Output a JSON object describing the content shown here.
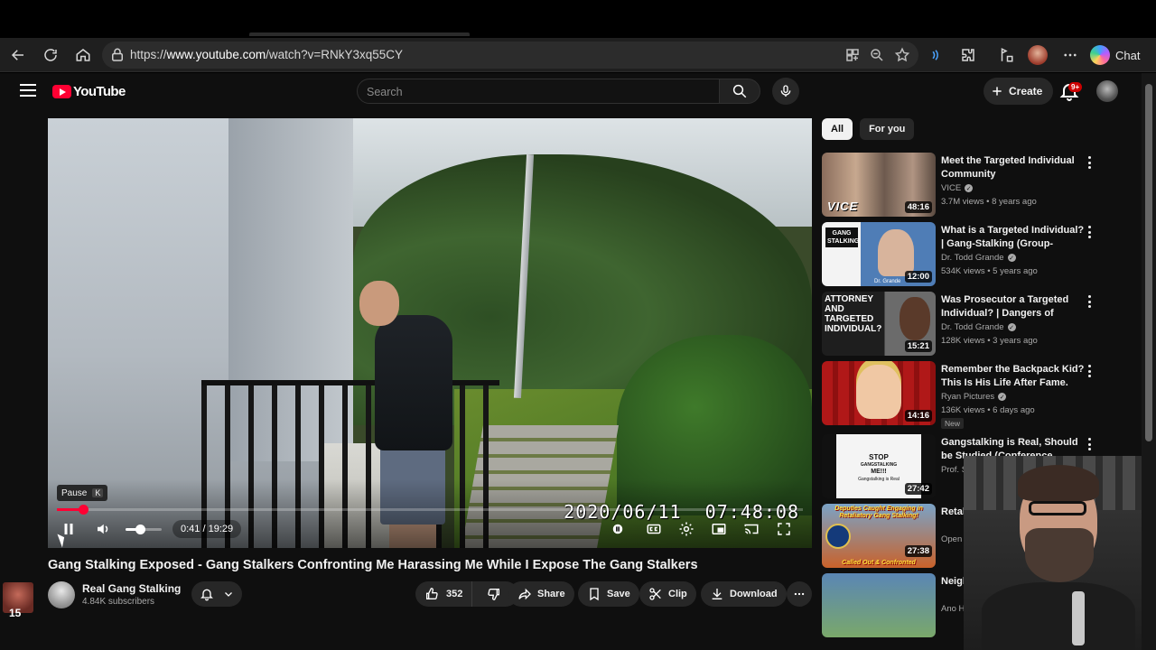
{
  "browser": {
    "url_prefix": "https://",
    "url_host": "www.youtube.com",
    "url_path": "/watch?v=RNkY3xq55CY",
    "chat_label": "Chat"
  },
  "youtube": {
    "logo_text": "YouTube",
    "search_placeholder": "Search",
    "create_label": "Create",
    "notification_badge": "9+"
  },
  "player": {
    "tooltip_label": "Pause",
    "tooltip_key": "K",
    "time_display": "0:41 / 19:29",
    "progress_fraction": 0.035,
    "volume_fraction": 0.4,
    "overlay_timestamp": "2020/06/11  07:48:08"
  },
  "video": {
    "title": "Gang Stalking Exposed - Gang Stalkers Confronting Me Harassing Me While I Expose The Gang Stalkers",
    "channel_name": "Real Gang Stalking",
    "subscribers": "4.84K subscribers",
    "like_count": "352",
    "share_label": "Share",
    "save_label": "Save",
    "clip_label": "Clip",
    "download_label": "Download"
  },
  "sidebar": {
    "chips": [
      {
        "label": "All"
      },
      {
        "label": "For you"
      }
    ],
    "recommendations": [
      {
        "title": "Meet the Targeted Individual Community",
        "channel": "VICE",
        "meta": "3.7M views • 8 years ago",
        "duration": "48:16",
        "badge": "",
        "thumb_color": "#6d5a4e"
      },
      {
        "title": "What is a Targeted Individual? | Gang-Stalking (Group-Stalking)",
        "channel": "Dr. Todd Grande",
        "meta": "534K views • 5 years ago",
        "duration": "12:00",
        "badge": "",
        "thumb_color": "#3a5a8a"
      },
      {
        "title": "Was Prosecutor a Targeted Individual? | Dangers of Gang-...",
        "channel": "Dr. Todd Grande",
        "meta": "128K views • 3 years ago",
        "duration": "15:21",
        "badge": "",
        "thumb_color": "#2a2a2a"
      },
      {
        "title": "Remember the Backpack Kid? This Is His Life After Fame.",
        "channel": "Ryan Pictures",
        "meta": "136K views • 6 days ago",
        "duration": "14:16",
        "badge": "New",
        "thumb_color": "#b01818"
      },
      {
        "title": "Gangstalking is Real, Should be Studied (Conference Keynote...",
        "channel": "Prof. S",
        "meta": "",
        "duration": "27:42",
        "badge": "",
        "thumb_color": "#e8e8e8"
      },
      {
        "title": "Retal... Depu...",
        "channel": "Open",
        "meta": "",
        "duration": "27:38",
        "badge": "",
        "thumb_color": "#c9622a"
      },
      {
        "title": "Neigl... Riddl...",
        "channel": "Ano H",
        "meta": "",
        "duration": "",
        "badge": "",
        "thumb_color": "#5a86b5"
      }
    ],
    "thumb_texts": {
      "t1": "VICE",
      "t2a": "GANG",
      "t2b": "STALKING",
      "t2c": "Dr. Grande",
      "t3": "ATTORNEY AND TARGETED INDIVIDUAL?",
      "t5a": "STOP",
      "t5b": "GANGSTALKING",
      "t5c": "ME!!!",
      "t5d": "Gangstalking is Real",
      "t6a": "Deputies Caught Engaging in Retaliatory Gang Stalking!",
      "t6b": "Called Out & Confronted"
    }
  },
  "page": {
    "corner_number": "15"
  }
}
